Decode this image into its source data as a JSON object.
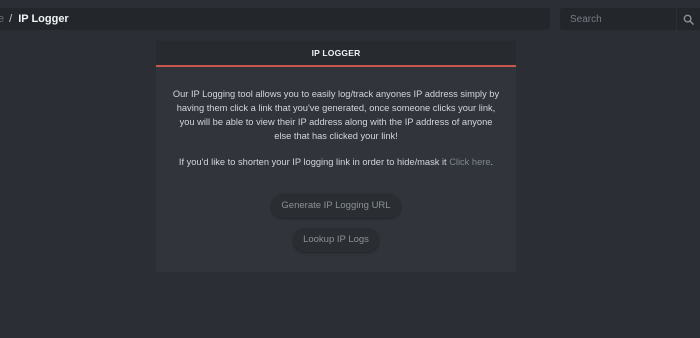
{
  "breadcrumb": {
    "home_fragment": "e",
    "separator": "/",
    "current": "IP Logger"
  },
  "search": {
    "placeholder": "Search",
    "icon": "search-icon"
  },
  "panel": {
    "title": "IP LOGGER",
    "description": "Our IP Logging tool allows you to easily log/track anyones IP address simply by having them click a link that you've generated, once someone clicks your link, you will be able to view their IP address along with the IP address of anyone else that has clicked your link!",
    "shorten_prefix": "If you'd like to shorten your IP logging link in order to hide/mask it ",
    "shorten_link": "Click here",
    "shorten_suffix": ".",
    "generate_button": "Generate IP Logging URL",
    "lookup_button": "Lookup IP Logs"
  },
  "colors": {
    "background": "#2b2f35",
    "panel": "#31353b",
    "panel_header": "#272b30",
    "accent": "#c9554b"
  }
}
